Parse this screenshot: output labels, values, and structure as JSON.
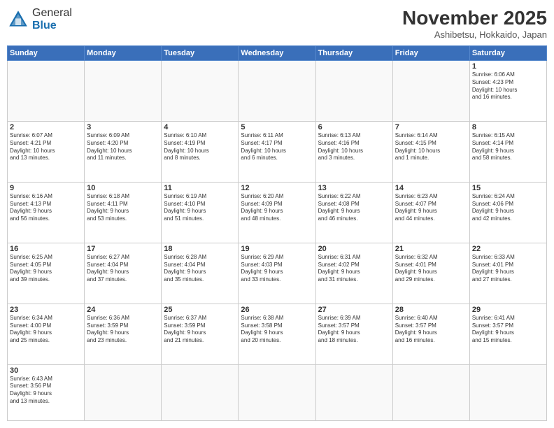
{
  "header": {
    "logo_general": "General",
    "logo_blue": "Blue",
    "month_title": "November 2025",
    "subtitle": "Ashibetsu, Hokkaido, Japan"
  },
  "days_of_week": [
    "Sunday",
    "Monday",
    "Tuesday",
    "Wednesday",
    "Thursday",
    "Friday",
    "Saturday"
  ],
  "weeks": [
    [
      {
        "day": "",
        "info": ""
      },
      {
        "day": "",
        "info": ""
      },
      {
        "day": "",
        "info": ""
      },
      {
        "day": "",
        "info": ""
      },
      {
        "day": "",
        "info": ""
      },
      {
        "day": "",
        "info": ""
      },
      {
        "day": "1",
        "info": "Sunrise: 6:06 AM\nSunset: 4:23 PM\nDaylight: 10 hours\nand 16 minutes."
      }
    ],
    [
      {
        "day": "2",
        "info": "Sunrise: 6:07 AM\nSunset: 4:21 PM\nDaylight: 10 hours\nand 13 minutes."
      },
      {
        "day": "3",
        "info": "Sunrise: 6:09 AM\nSunset: 4:20 PM\nDaylight: 10 hours\nand 11 minutes."
      },
      {
        "day": "4",
        "info": "Sunrise: 6:10 AM\nSunset: 4:19 PM\nDaylight: 10 hours\nand 8 minutes."
      },
      {
        "day": "5",
        "info": "Sunrise: 6:11 AM\nSunset: 4:17 PM\nDaylight: 10 hours\nand 6 minutes."
      },
      {
        "day": "6",
        "info": "Sunrise: 6:13 AM\nSunset: 4:16 PM\nDaylight: 10 hours\nand 3 minutes."
      },
      {
        "day": "7",
        "info": "Sunrise: 6:14 AM\nSunset: 4:15 PM\nDaylight: 10 hours\nand 1 minute."
      },
      {
        "day": "8",
        "info": "Sunrise: 6:15 AM\nSunset: 4:14 PM\nDaylight: 9 hours\nand 58 minutes."
      }
    ],
    [
      {
        "day": "9",
        "info": "Sunrise: 6:16 AM\nSunset: 4:13 PM\nDaylight: 9 hours\nand 56 minutes."
      },
      {
        "day": "10",
        "info": "Sunrise: 6:18 AM\nSunset: 4:11 PM\nDaylight: 9 hours\nand 53 minutes."
      },
      {
        "day": "11",
        "info": "Sunrise: 6:19 AM\nSunset: 4:10 PM\nDaylight: 9 hours\nand 51 minutes."
      },
      {
        "day": "12",
        "info": "Sunrise: 6:20 AM\nSunset: 4:09 PM\nDaylight: 9 hours\nand 48 minutes."
      },
      {
        "day": "13",
        "info": "Sunrise: 6:22 AM\nSunset: 4:08 PM\nDaylight: 9 hours\nand 46 minutes."
      },
      {
        "day": "14",
        "info": "Sunrise: 6:23 AM\nSunset: 4:07 PM\nDaylight: 9 hours\nand 44 minutes."
      },
      {
        "day": "15",
        "info": "Sunrise: 6:24 AM\nSunset: 4:06 PM\nDaylight: 9 hours\nand 42 minutes."
      }
    ],
    [
      {
        "day": "16",
        "info": "Sunrise: 6:25 AM\nSunset: 4:05 PM\nDaylight: 9 hours\nand 39 minutes."
      },
      {
        "day": "17",
        "info": "Sunrise: 6:27 AM\nSunset: 4:04 PM\nDaylight: 9 hours\nand 37 minutes."
      },
      {
        "day": "18",
        "info": "Sunrise: 6:28 AM\nSunset: 4:04 PM\nDaylight: 9 hours\nand 35 minutes."
      },
      {
        "day": "19",
        "info": "Sunrise: 6:29 AM\nSunset: 4:03 PM\nDaylight: 9 hours\nand 33 minutes."
      },
      {
        "day": "20",
        "info": "Sunrise: 6:31 AM\nSunset: 4:02 PM\nDaylight: 9 hours\nand 31 minutes."
      },
      {
        "day": "21",
        "info": "Sunrise: 6:32 AM\nSunset: 4:01 PM\nDaylight: 9 hours\nand 29 minutes."
      },
      {
        "day": "22",
        "info": "Sunrise: 6:33 AM\nSunset: 4:01 PM\nDaylight: 9 hours\nand 27 minutes."
      }
    ],
    [
      {
        "day": "23",
        "info": "Sunrise: 6:34 AM\nSunset: 4:00 PM\nDaylight: 9 hours\nand 25 minutes."
      },
      {
        "day": "24",
        "info": "Sunrise: 6:36 AM\nSunset: 3:59 PM\nDaylight: 9 hours\nand 23 minutes."
      },
      {
        "day": "25",
        "info": "Sunrise: 6:37 AM\nSunset: 3:59 PM\nDaylight: 9 hours\nand 21 minutes."
      },
      {
        "day": "26",
        "info": "Sunrise: 6:38 AM\nSunset: 3:58 PM\nDaylight: 9 hours\nand 20 minutes."
      },
      {
        "day": "27",
        "info": "Sunrise: 6:39 AM\nSunset: 3:57 PM\nDaylight: 9 hours\nand 18 minutes."
      },
      {
        "day": "28",
        "info": "Sunrise: 6:40 AM\nSunset: 3:57 PM\nDaylight: 9 hours\nand 16 minutes."
      },
      {
        "day": "29",
        "info": "Sunrise: 6:41 AM\nSunset: 3:57 PM\nDaylight: 9 hours\nand 15 minutes."
      }
    ],
    [
      {
        "day": "30",
        "info": "Sunrise: 6:43 AM\nSunset: 3:56 PM\nDaylight: 9 hours\nand 13 minutes."
      },
      {
        "day": "",
        "info": ""
      },
      {
        "day": "",
        "info": ""
      },
      {
        "day": "",
        "info": ""
      },
      {
        "day": "",
        "info": ""
      },
      {
        "day": "",
        "info": ""
      },
      {
        "day": "",
        "info": ""
      }
    ]
  ]
}
